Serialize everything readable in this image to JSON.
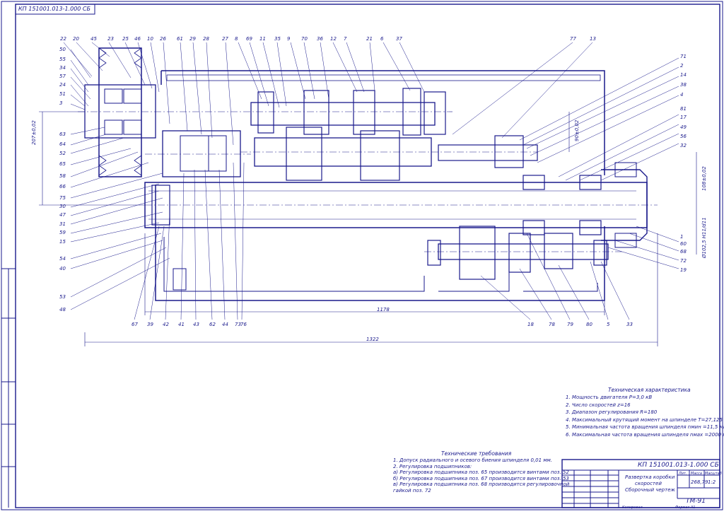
{
  "stamp_code_top": "КП 151001.013-1.000 СБ",
  "title_block": {
    "doc_code": "КП 151001.013-1.000 СБ",
    "title_lines": [
      "Развертка коробки",
      "скоростей",
      "Сборочный чертеж"
    ],
    "group": "ТМ-91",
    "sheet_mark": "Лит.",
    "mass_label": "Масса",
    "scale_label": "Масштаб",
    "mass": "268,79",
    "scale": "1:2",
    "copied": "Копировал",
    "format": "Формат   А1"
  },
  "tech_spec": {
    "title": "Техническая характеристика",
    "lines": [
      "1. Мощность двигателя P=3,0 кВ",
      "2. Число скоростей z=16",
      "3. Диапазон регулирования R=180",
      "4. Максимальный крутящий момент на шпинделе T=27,125 Нм",
      "5. Минимальная частота вращения шпинделя nмин =11,5 мин⁻¹",
      "6. Максимальная частота вращения шпинделя nмах =2000 мин⁻¹"
    ]
  },
  "tech_req": {
    "title": "Технические требования",
    "lines": [
      "1. Допуск радиального и осевого биения шпинделя 0,01 мм.",
      "2. Регулировка подшипников:",
      "а) Регулировка подшипника поз. 65 производится винтами поз. 52",
      "б) Регулировка подшипника поз. 67 производится винтами поз. 53",
      "в) Регулировка подшипника поз. 68 производится регулировочной",
      "гайкой поз. 72"
    ]
  },
  "dims": {
    "d1178": "1178",
    "d1322": "1322",
    "d207": "207±0,02",
    "d108": "108±0,02",
    "d90": "90±0,02",
    "d1025": "Ø102,5 H11/d11"
  },
  "callouts_top": [
    "22",
    "20",
    "45",
    "23",
    "25",
    "46",
    "10",
    "26",
    "61",
    "29",
    "28",
    "27",
    "8",
    "69",
    "11",
    "35",
    "9",
    "70",
    "36",
    "12",
    "7",
    "21",
    "6",
    "37",
    "77",
    "13"
  ],
  "callouts_left": [
    "50",
    "55",
    "34",
    "57",
    "24",
    "51",
    "3",
    "63",
    "64",
    "52",
    "65",
    "58",
    "66",
    "75",
    "30",
    "47",
    "31",
    "59",
    "15",
    "54",
    "40",
    "53",
    "48"
  ],
  "callouts_bottom": [
    "67",
    "39",
    "42",
    "41",
    "43",
    "62",
    "44",
    "73",
    "76",
    "18",
    "78",
    "79",
    "80",
    "5",
    "33"
  ],
  "callouts_right": [
    "71",
    "2",
    "14",
    "38",
    "4",
    "81",
    "17",
    "49",
    "56",
    "32",
    "1",
    "60",
    "68",
    "72",
    "19"
  ]
}
